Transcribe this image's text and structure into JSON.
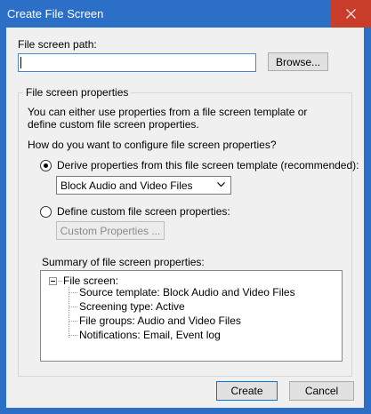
{
  "window": {
    "title": "Create File Screen"
  },
  "path": {
    "label": "File screen path:",
    "value": "",
    "browse_label": "Browse..."
  },
  "properties": {
    "group_label": "File screen properties",
    "description": "You can either use properties from a file screen template or define custom file screen properties.",
    "question": "How do you want to configure file screen properties?",
    "derive_label": "Derive properties from this file screen template (recommended):",
    "derive_checked": true,
    "template_selected": "Block Audio and Video Files",
    "custom_label": "Define custom file screen properties:",
    "custom_checked": false,
    "custom_button_label": "Custom Properties ..."
  },
  "summary": {
    "label": "Summary of file screen properties:",
    "root": "File screen:",
    "items": [
      "Source template: Block Audio and Video Files",
      "Screening type: Active",
      "File groups: Audio and Video Files",
      "Notifications: Email, Event log"
    ]
  },
  "footer": {
    "create_label": "Create",
    "cancel_label": "Cancel"
  },
  "colors": {
    "titlebar": "#2b6fc7",
    "close": "#c83c2a",
    "dialog_bg": "#f0f0f0"
  }
}
